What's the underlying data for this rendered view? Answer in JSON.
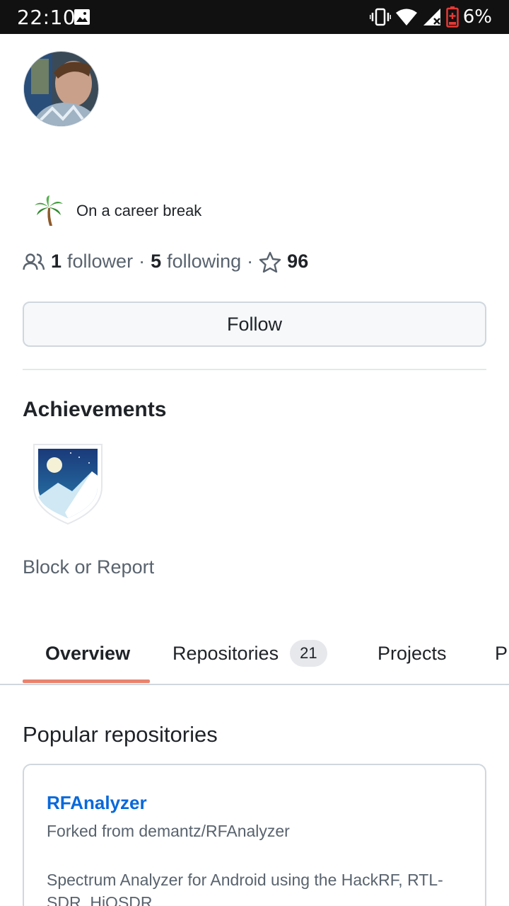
{
  "status_bar": {
    "time": "22:10",
    "battery_percent": "6%",
    "icons": [
      "image-icon",
      "vibrate-icon",
      "wifi-icon",
      "signal-icon",
      "battery-icon"
    ]
  },
  "profile": {
    "status_emoji": "palm-tree-icon",
    "status_text": "On a career break",
    "followers_count": "1",
    "followers_label": "follower",
    "following_count": "5",
    "following_label": "following",
    "stars_count": "96",
    "separator": "·",
    "follow_button": "Follow"
  },
  "achievements": {
    "title": "Achievements",
    "badges": [
      "achievement-badge-icon"
    ]
  },
  "block_report": "Block or Report",
  "tabs": [
    {
      "label": "Overview",
      "active": true
    },
    {
      "label": "Repositories",
      "count": "21"
    },
    {
      "label": "Projects"
    },
    {
      "label": "P"
    }
  ],
  "popular": {
    "title": "Popular repositories",
    "repos": [
      {
        "name": "RFAnalyzer",
        "forked_from": "Forked from demantz/RFAnalyzer",
        "description": "Spectrum Analyzer for Android using the HackRF, RTL-SDR, HiQSDR"
      }
    ]
  },
  "colors": {
    "link": "#0969da",
    "muted": "#59636e",
    "tab_underline": "#e9836e",
    "border": "#d0d7de"
  }
}
